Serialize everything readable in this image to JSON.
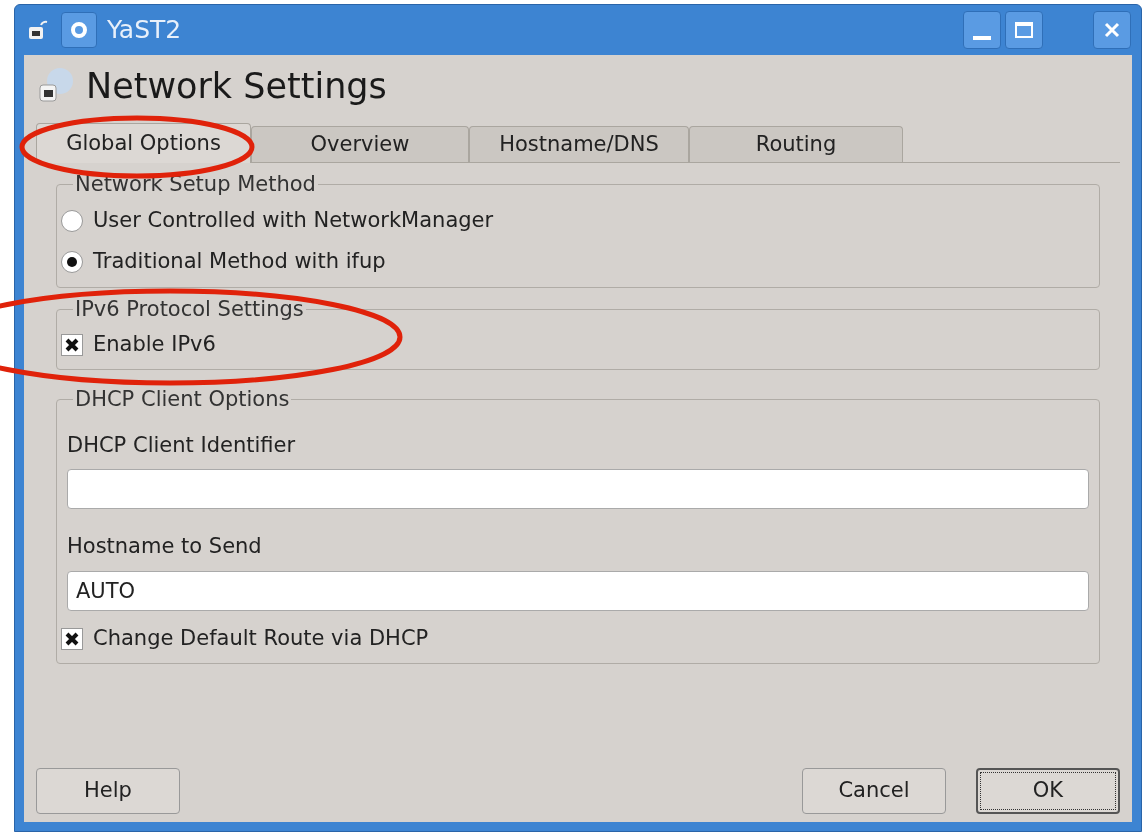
{
  "window": {
    "title": "YaST2"
  },
  "heading": "Network Settings",
  "tabs": [
    {
      "label": "Global Options",
      "selected": true
    },
    {
      "label": "Overview",
      "selected": false
    },
    {
      "label": "Hostname/DNS",
      "selected": false
    },
    {
      "label": "Routing",
      "selected": false
    }
  ],
  "groups": [
    {
      "title": "Network Setup Method",
      "items": [
        {
          "kind": "radio",
          "label": "User Controlled with NetworkManager",
          "selected": false
        },
        {
          "kind": "radio",
          "label": "Traditional Method with ifup",
          "selected": true
        }
      ]
    },
    {
      "title": "IPv6 Protocol Settings",
      "items": [
        {
          "kind": "checkbox",
          "label": "Enable IPv6",
          "checked": true
        }
      ]
    },
    {
      "title": "DHCP Client Options",
      "items": [
        {
          "kind": "field",
          "label": "DHCP Client Identifier"
        },
        {
          "kind": "field",
          "label": "Hostname to Send",
          "value": "AUTO"
        },
        {
          "kind": "checkbox",
          "label": "Change Default Route via DHCP",
          "checked": true
        }
      ]
    }
  ],
  "buttons": [
    {
      "label": "Help",
      "default": false
    },
    {
      "label": "Cancel",
      "default": false
    },
    {
      "label": "OK",
      "default": true
    }
  ]
}
